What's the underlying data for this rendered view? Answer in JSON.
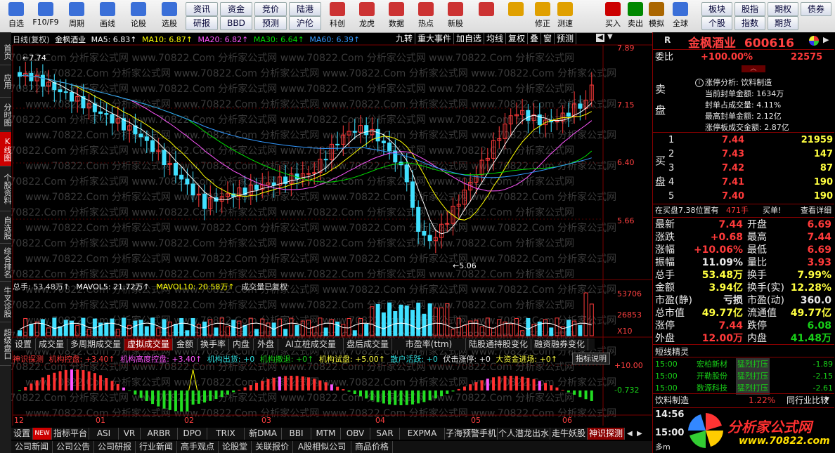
{
  "toolbar": {
    "items": [
      {
        "label": "自选",
        "icon": "star-icon",
        "color": "#3a6fd8"
      },
      {
        "label": "F10/F9",
        "icon": "f10-icon",
        "color": "#3a6fd8"
      },
      {
        "label": "周期",
        "icon": "clock-icon",
        "color": "#3a6fd8"
      },
      {
        "label": "画线",
        "icon": "pencil-icon",
        "color": "#3a6fd8"
      },
      {
        "label": "论股",
        "icon": "chat-icon",
        "color": "#3a6fd8"
      },
      {
        "label": "选股",
        "icon": "filter-icon",
        "color": "#3a6fd8"
      }
    ],
    "grid_buttons": [
      "资讯",
      "资金",
      "竞价",
      "陆港",
      "研报",
      "BBD",
      "预测",
      "沪伦"
    ],
    "items2": [
      {
        "label": "科创",
        "icon": "chart-icon",
        "color": "#cc3333"
      },
      {
        "label": "龙虎",
        "icon": "dragon-icon",
        "color": "#cc3333"
      },
      {
        "label": "数据",
        "icon": "pe-icon",
        "color": "#cc3333"
      },
      {
        "label": "热点",
        "icon": "hot-icon",
        "color": "#cc3333"
      },
      {
        "label": "新股",
        "icon": "ipo-icon",
        "color": "#cc3333"
      }
    ],
    "items3": [
      {
        "label": "",
        "icon": "palette-icon",
        "color": "#cc3333"
      },
      {
        "label": "",
        "icon": "back-arrow-icon",
        "color": "#e0a000"
      },
      {
        "label": "修正",
        "icon": "up-down-icon",
        "color": "#e0a000"
      },
      {
        "label": "测速",
        "icon": "speed-icon",
        "color": "#e0a000"
      },
      {
        "label": "买入",
        "icon": "buy-icon",
        "color": "#cc0000"
      },
      {
        "label": "卖出",
        "icon": "sell-icon",
        "color": "#008800"
      },
      {
        "label": "模拟",
        "icon": "hammer-icon",
        "color": "#aa6600"
      },
      {
        "label": "全球",
        "icon": "globe-icon",
        "color": "#3a6fd8"
      }
    ],
    "grid_buttons2": [
      "板块",
      "股指",
      "期权",
      "债券",
      "个股",
      "指数",
      "期货"
    ]
  },
  "left_tabs": [
    "首页",
    "应用",
    "分时图",
    "K线图",
    "个股资料",
    "自选股",
    "综合排名",
    "牛叉诊股",
    "超级盘口"
  ],
  "main_header": {
    "period": "日线(复权)",
    "name": "金枫酒业",
    "ma5": "MA5: 6.83↑",
    "ma10": "MA10: 6.87↑",
    "ma20": "MA20: 6.82↑",
    "ma30": "MA30: 6.64↑",
    "ma60": "MA60: 6.39↑",
    "buttons": [
      "九转",
      "重大事件",
      "加自选",
      "均线",
      "复权",
      "叠",
      "窗",
      "预测"
    ]
  },
  "price_axis": [
    "7.89",
    "7.15",
    "6.40",
    "5.66"
  ],
  "price_marks": {
    "high": "7.74",
    "low": "5.06"
  },
  "volume_header": {
    "total": "总手: 53.48万↑",
    "mavol5": "MAVOL5: 21.72万↑",
    "mavol10": "MAVOL10: 20.58万↑",
    "note": "成交量已复权"
  },
  "volume_axis": [
    "53706",
    "26853",
    "X10"
  ],
  "indicator_tabs": [
    "设置",
    "成交量",
    "多周期成交量",
    "虚拟成交量",
    "金额",
    "换手率",
    "内盘",
    "外盘",
    "AI立桩成交量",
    "盘后成交量",
    "市盈率(ttm)",
    "陆股通持股变化",
    "融资融券变化"
  ],
  "indicator_tabs_active": 3,
  "detect_header": {
    "name": "神识探测",
    "ctrl": "机构控盘: +3.40↑",
    "high": "机构高度控盘: +3.40↑",
    "ship": "机构出货: +0",
    "leave": "机构撤退: +0↑",
    "test": "机构试盘: +5.00↑",
    "retail": "散户活跃: +0",
    "ambush": "伏击涨停: +0",
    "bigfund": "大资金进场: +0↑",
    "explain": "指标说明"
  },
  "detect_axis": [
    "+10.00",
    "-0.732"
  ],
  "time_axis": [
    "12",
    "01",
    "02",
    "03",
    "04",
    "05",
    "06"
  ],
  "bottom_tabs": [
    "设置",
    "NEW",
    "指标平台",
    "ASI",
    "VR",
    "ARBR",
    "DPO",
    "TRIX",
    "新DMA",
    "BBI",
    "MTM",
    "OBV",
    "SAR",
    "EXPMA",
    "子海预警手机",
    "个人潜龙出水",
    "走牛妖股",
    "神识探测"
  ],
  "bottom_tabs_active": 17,
  "bottom_row2": [
    "公司新闻",
    "公司公告",
    "公司研报",
    "行业新闻",
    "高手观点",
    "论股堂",
    "关联报价",
    "A股相似公司",
    "商品价格"
  ],
  "stock": {
    "name": "金枫酒业",
    "code": "600616"
  },
  "order": {
    "wei_bi_label": "委比",
    "wei_bi": "+100.00%",
    "wei_cha": "22575",
    "sell_label": "卖",
    "sell_label2": "盘",
    "limit_info": [
      "涨停分析: 饮料制造",
      "当前封单金额: 1634万",
      "封单占成交量: 4.11%",
      "最高封单金额: 2.12亿",
      "涨停板成交金额: 2.87亿"
    ],
    "buy_label": "买",
    "buy_label2": "盘",
    "buys": [
      {
        "lvl": "1",
        "price": "7.44",
        "vol": "21959"
      },
      {
        "lvl": "2",
        "price": "7.43",
        "vol": "147"
      },
      {
        "lvl": "3",
        "price": "7.42",
        "vol": "87"
      },
      {
        "lvl": "4",
        "price": "7.41",
        "vol": "190"
      },
      {
        "lvl": "5",
        "price": "7.40",
        "vol": "190"
      }
    ],
    "tape": {
      "text": "在买盘7.38位置有",
      "qty": "471手",
      "action": "买单!",
      "more": "查看详细"
    }
  },
  "quote": [
    {
      "l": "最新",
      "v": "7.44",
      "vc": "red",
      "l2": "开盘",
      "v2": "6.69",
      "v2c": "red"
    },
    {
      "l": "涨跌",
      "v": "+0.68",
      "vc": "red",
      "l2": "最高",
      "v2": "7.44",
      "v2c": "red"
    },
    {
      "l": "涨幅",
      "v": "+10.06%",
      "vc": "red",
      "l2": "最低",
      "v2": "6.69",
      "v2c": "red"
    },
    {
      "l": "振幅",
      "v": "11.09%",
      "vc": "white",
      "l2": "量比",
      "v2": "3.93",
      "v2c": "red"
    },
    {
      "l": "总手",
      "v": "53.48万",
      "vc": "yellow",
      "l2": "换手",
      "v2": "7.99%",
      "v2c": "yellow"
    },
    {
      "l": "金额",
      "v": "3.94亿",
      "vc": "yellow",
      "l2": "换手(实)",
      "v2": "12.28%",
      "v2c": "yellow"
    },
    {
      "l": "市盈(静)",
      "v": "亏损",
      "vc": "white",
      "l2": "市盈(动)",
      "v2": "360.0",
      "v2c": "white"
    },
    {
      "l": "总市值",
      "v": "49.77亿",
      "vc": "yellow",
      "l2": "流通值",
      "v2": "49.77亿",
      "v2c": "yellow"
    },
    {
      "l": "涨停",
      "v": "7.44",
      "vc": "red",
      "l2": "跌停",
      "v2": "6.08",
      "v2c": "green"
    },
    {
      "l": "外盘",
      "v": "12.00万",
      "vc": "red",
      "l2": "内盘",
      "v2": "41.48万",
      "v2c": "green"
    }
  ],
  "spirit": {
    "title": "短线精灵",
    "rows": [
      {
        "time": "15:00",
        "name": "宏柏新材",
        "event": "猛烈打压",
        "val": "-1.89"
      },
      {
        "time": "15:00",
        "name": "开勒股份",
        "event": "猛烈打压",
        "val": "-2.15"
      },
      {
        "time": "15:00",
        "name": "数源科技",
        "event": "猛烈打压",
        "val": "-2.61"
      }
    ]
  },
  "industry": {
    "name": "饮料制造",
    "pct": "1.22%",
    "compare": "同行业比较"
  },
  "mini": {
    "t1": "14:56",
    "t2": "15:00",
    "t3": "多m"
  },
  "watermark": {
    "brand": "分析家公式网",
    "url": "www.70822.com",
    "repeat": "www.70822.Com 分析家公式网"
  },
  "colors": {
    "up": "#ff3a3a",
    "down": "#40e0ff",
    "ma5": "#ffffff",
    "ma10": "#ffff00",
    "ma20": "#ff55ff",
    "ma30": "#00dd00",
    "ma60": "#3399ff"
  }
}
